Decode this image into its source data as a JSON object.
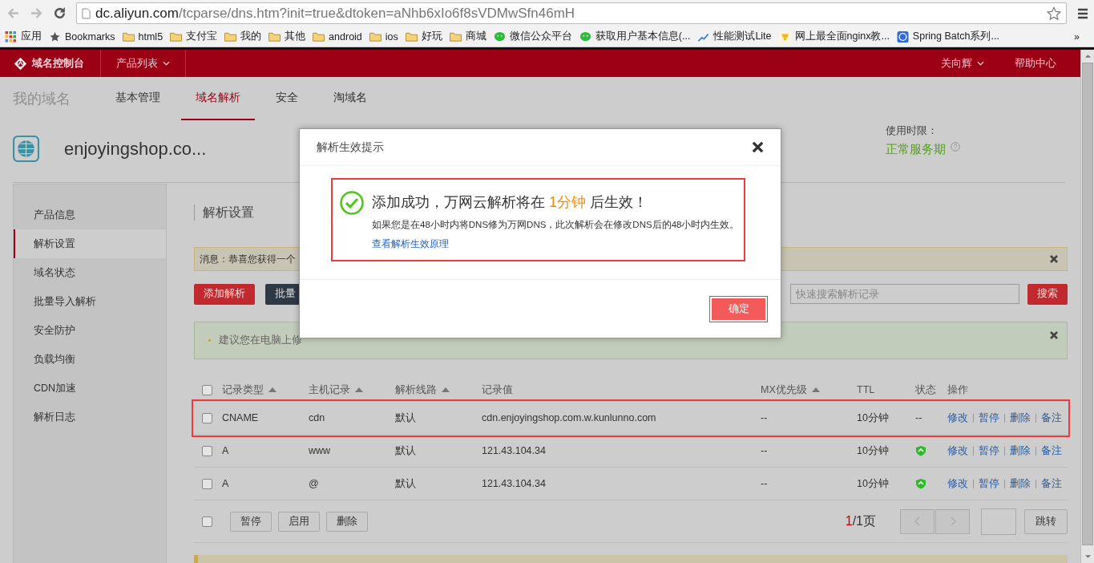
{
  "browser": {
    "url_host": "dc.aliyun.com",
    "url_path": "/tcparse/dns.htm?init=true&dtoken=aNhb6xIo6f8sVDMwSfn46mH",
    "bookmarks": [
      {
        "label": "应用",
        "kind": "apps"
      },
      {
        "label": "Bookmarks",
        "kind": "star"
      },
      {
        "label": "html5",
        "kind": "folder"
      },
      {
        "label": "支付宝",
        "kind": "folder"
      },
      {
        "label": "我的",
        "kind": "folder"
      },
      {
        "label": "其他",
        "kind": "folder"
      },
      {
        "label": "android",
        "kind": "folder"
      },
      {
        "label": "ios",
        "kind": "folder"
      },
      {
        "label": "好玩",
        "kind": "folder"
      },
      {
        "label": "商城",
        "kind": "folder"
      },
      {
        "label": "微信公众平台",
        "kind": "chat"
      },
      {
        "label": "获取用户基本信息(...",
        "kind": "chat"
      },
      {
        "label": "性能测试Lite",
        "kind": "chart"
      },
      {
        "label": "网上最全面nginx教...",
        "kind": "bell"
      },
      {
        "label": "Spring Batch系列...",
        "kind": "site"
      }
    ],
    "overflow": "»"
  },
  "topnav": {
    "brand": "域名控制台",
    "menu": "产品列表",
    "user": "关向辉",
    "help": "帮助中心"
  },
  "subnav": {
    "title": "我的域名",
    "tabs": [
      {
        "label": "基本管理",
        "selected": false
      },
      {
        "label": "域名解析",
        "selected": true
      },
      {
        "label": "安全",
        "selected": false
      },
      {
        "label": "淘域名",
        "selected": false
      }
    ]
  },
  "domain": {
    "name": "enjoyingshop.co...",
    "term_label": "使用时限：",
    "term_status": "正常服务期"
  },
  "sidebar": {
    "items": [
      {
        "label": "产品信息",
        "selected": false
      },
      {
        "label": "解析设置",
        "selected": true
      },
      {
        "label": "域名状态",
        "selected": false
      },
      {
        "label": "批量导入解析",
        "selected": false
      },
      {
        "label": "安全防护",
        "selected": false
      },
      {
        "label": "负载均衡",
        "selected": false
      },
      {
        "label": "CDN加速",
        "selected": false
      },
      {
        "label": "解析日志",
        "selected": false
      }
    ]
  },
  "main": {
    "title": "解析设置",
    "message": "消息：恭喜您获得一个",
    "buttons": [
      {
        "label": "添加解析",
        "kind": "primary"
      },
      {
        "label": "批量",
        "kind": "dark"
      }
    ],
    "search": {
      "placeholder": "快速搜索解析记录",
      "button": "搜索"
    },
    "tip": "建议您在电脑上修"
  },
  "table": {
    "select_all_checked": false,
    "columns": [
      {
        "label": "记录类型",
        "sortable": true
      },
      {
        "label": "主机记录",
        "sortable": true
      },
      {
        "label": "解析线路",
        "sortable": true
      },
      {
        "label": "记录值",
        "sortable": false
      },
      {
        "label": "MX优先级",
        "sortable": true
      },
      {
        "label": "TTL",
        "sortable": false
      },
      {
        "label": "状态",
        "sortable": false
      },
      {
        "label": "操作",
        "sortable": false
      }
    ],
    "rows": [
      {
        "checked": false,
        "annotated": true,
        "type": "CNAME",
        "host": "cdn",
        "line": "默认",
        "value": "cdn.enjoyingshop.com.w.kunlunno.com",
        "mx": "--",
        "ttl": "10分钟",
        "status": {
          "kind": "text",
          "text": "--"
        },
        "actions": [
          "修改",
          "暂停",
          "删除",
          "备注"
        ]
      },
      {
        "checked": false,
        "annotated": false,
        "type": "A",
        "host": "www",
        "line": "默认",
        "value": "121.43.104.34",
        "mx": "--",
        "ttl": "10分钟",
        "status": {
          "kind": "ok"
        },
        "actions": [
          "修改",
          "暂停",
          "删除",
          "备注"
        ]
      },
      {
        "checked": false,
        "annotated": false,
        "type": "A",
        "host": "@",
        "line": "默认",
        "value": "121.43.104.34",
        "mx": "--",
        "ttl": "10分钟",
        "status": {
          "kind": "ok"
        },
        "actions": [
          "修改",
          "暂停",
          "删除",
          "备注"
        ]
      }
    ]
  },
  "footer": {
    "select_all_checked": false,
    "buttons": [
      "暂停",
      "启用",
      "删除"
    ],
    "page_current": "1",
    "page_total": "/1页",
    "jump": "跳转"
  },
  "dialog": {
    "title": "解析生效提示",
    "annotated": true,
    "headline": {
      "before": "添加成功，万网云解析将在 ",
      "highlight": "1分钟",
      "after": " 后生效！"
    },
    "note": "如果您是在48小时内将DNS修为万网DNS，此次解析会在修改DNS后的48小时内生效。",
    "link": "查看解析生效原理",
    "confirm": "确定",
    "confirm_annotated": true
  }
}
